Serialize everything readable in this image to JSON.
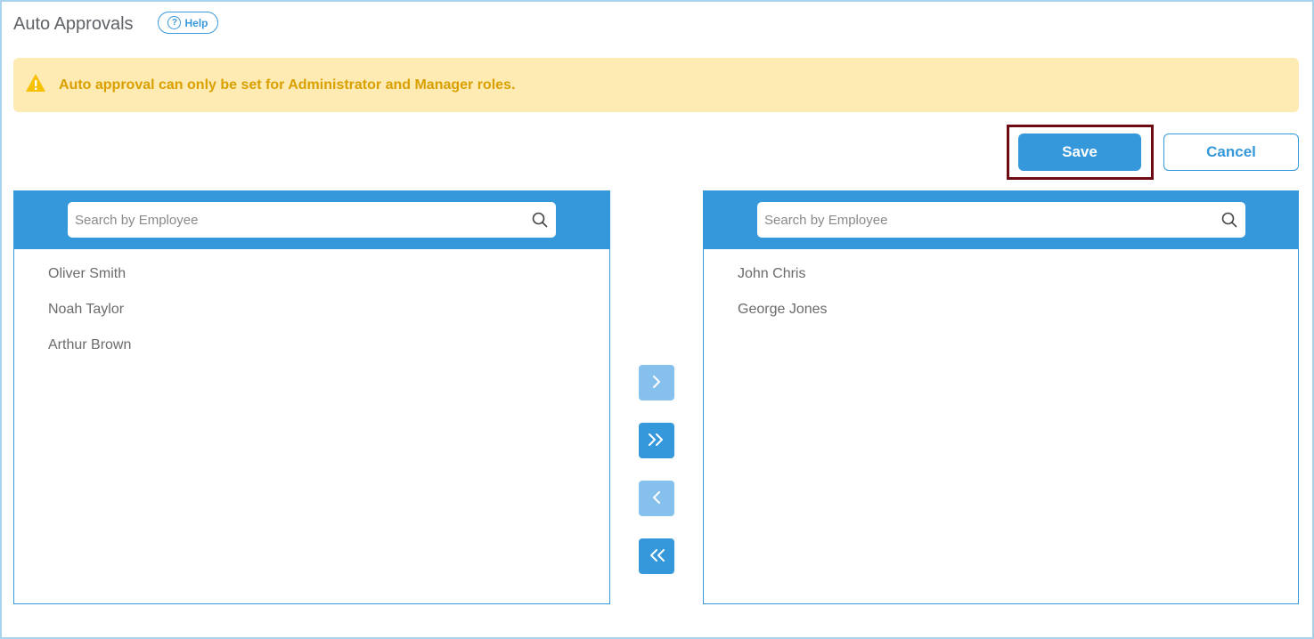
{
  "header": {
    "title": "Auto Approvals",
    "help_label": "Help"
  },
  "alert": {
    "text": "Auto approval can only be set for Administrator and Manager roles."
  },
  "actions": {
    "save_label": "Save",
    "cancel_label": "Cancel"
  },
  "left_panel": {
    "search_placeholder": "Search by Employee",
    "items": [
      "Oliver Smith",
      "Noah Taylor",
      "Arthur Brown"
    ]
  },
  "right_panel": {
    "search_placeholder": "Search by Employee",
    "items": [
      "John Chris",
      "George Jones"
    ]
  },
  "transfer_buttons": [
    {
      "name": "move-right",
      "icon": "chevron-right-icon",
      "enabled": false
    },
    {
      "name": "move-all-right",
      "icon": "double-chevron-right-icon",
      "enabled": true
    },
    {
      "name": "move-left",
      "icon": "chevron-left-icon",
      "enabled": false
    },
    {
      "name": "move-all-left",
      "icon": "double-chevron-left-icon",
      "enabled": true
    }
  ],
  "colors": {
    "primary": "#3598da",
    "primary_disabled": "#85c1ec",
    "alert_bg": "#feebb4",
    "alert_text": "#d9a000",
    "highlight_outline": "#6e0a13"
  }
}
